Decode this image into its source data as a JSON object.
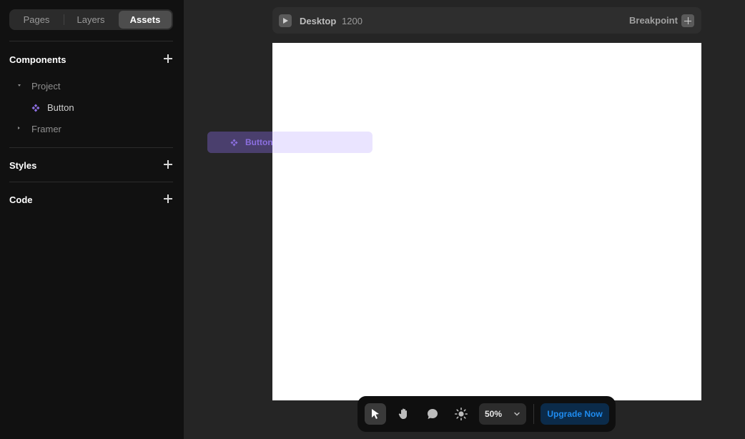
{
  "sidebar": {
    "tabs": [
      {
        "label": "Pages"
      },
      {
        "label": "Layers"
      },
      {
        "label": "Assets"
      }
    ],
    "sections": {
      "components": {
        "title": "Components"
      },
      "styles": {
        "title": "Styles"
      },
      "code": {
        "title": "Code"
      }
    },
    "tree": {
      "project": "Project",
      "button": "Button",
      "framer": "Framer"
    }
  },
  "canvas": {
    "breakpoint_name": "Desktop",
    "breakpoint_width": "1200",
    "breakpoint_label": "Breakpoint"
  },
  "drag_ghost": {
    "label": "Button"
  },
  "toolbar": {
    "zoom": "50%",
    "upgrade_label": "Upgrade Now"
  },
  "colors": {
    "accent": "#8c6fe0",
    "upgrade": "#1f8cf0",
    "background": "#252525",
    "sidebar": "#111111"
  },
  "icons": [
    "play-icon",
    "plus-icon",
    "component-icon",
    "cursor-icon",
    "hand-icon",
    "comment-icon",
    "sun-icon",
    "chevron-down-icon"
  ]
}
